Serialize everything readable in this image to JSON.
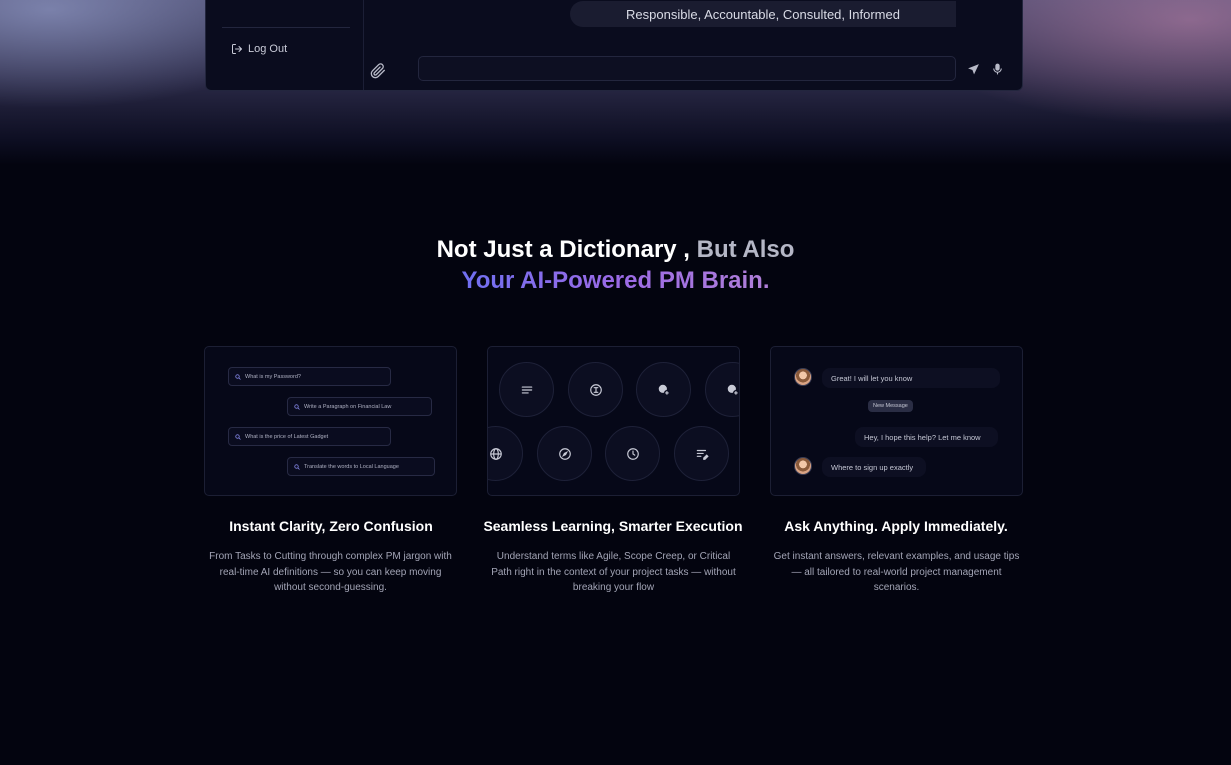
{
  "app_preview": {
    "logout_label": "Log Out",
    "message_chip": "Responsible, Accountable, Consulted, Informed",
    "input_value": "",
    "icons": [
      "logout-icon",
      "paperclip-icon",
      "send-icon",
      "microphone-icon"
    ]
  },
  "headline": {
    "part1": "Not Just a Dictionary ,",
    "part2": " But Also",
    "line2": "Your AI-Powered PM Brain."
  },
  "cards": {
    "search_examples": [
      "What is my Password?",
      "Write a Paragraph on Financial Law",
      "What is the price of Latest Gadget",
      "Translate the words to Local Language"
    ],
    "tool_icons": [
      "text-lines-icon",
      "cursor-text-icon",
      "brain-plus-icon",
      "brain-plus-icon",
      "globe-icon",
      "compass-icon",
      "clock-icon",
      "list-edit-icon"
    ],
    "chat": {
      "msg1": "Great! I will let you know",
      "badge": "New Message",
      "msg2": "Hey, I hope this help? Let me know",
      "msg3": "Where to sign up exactly"
    }
  },
  "features": [
    {
      "title": "Instant Clarity, Zero Confusion",
      "desc": "From Tasks to Cutting through complex PM jargon with real-time AI definitions — so you can keep moving without second-guessing."
    },
    {
      "title": "Seamless Learning, Smarter Execution",
      "desc": "Understand terms like Agile, Scope Creep, or Critical Path right in the context of your project tasks — without breaking your flow"
    },
    {
      "title": "Ask Anything. Apply Immediately.",
      "desc": "Get instant answers, relevant examples, and usage tips — all tailored to real-world project management scenarios."
    }
  ],
  "colors": {
    "background": "#03040f",
    "accent_gradient_start": "#6f6ff0",
    "accent_gradient_end": "#b07fd8"
  }
}
